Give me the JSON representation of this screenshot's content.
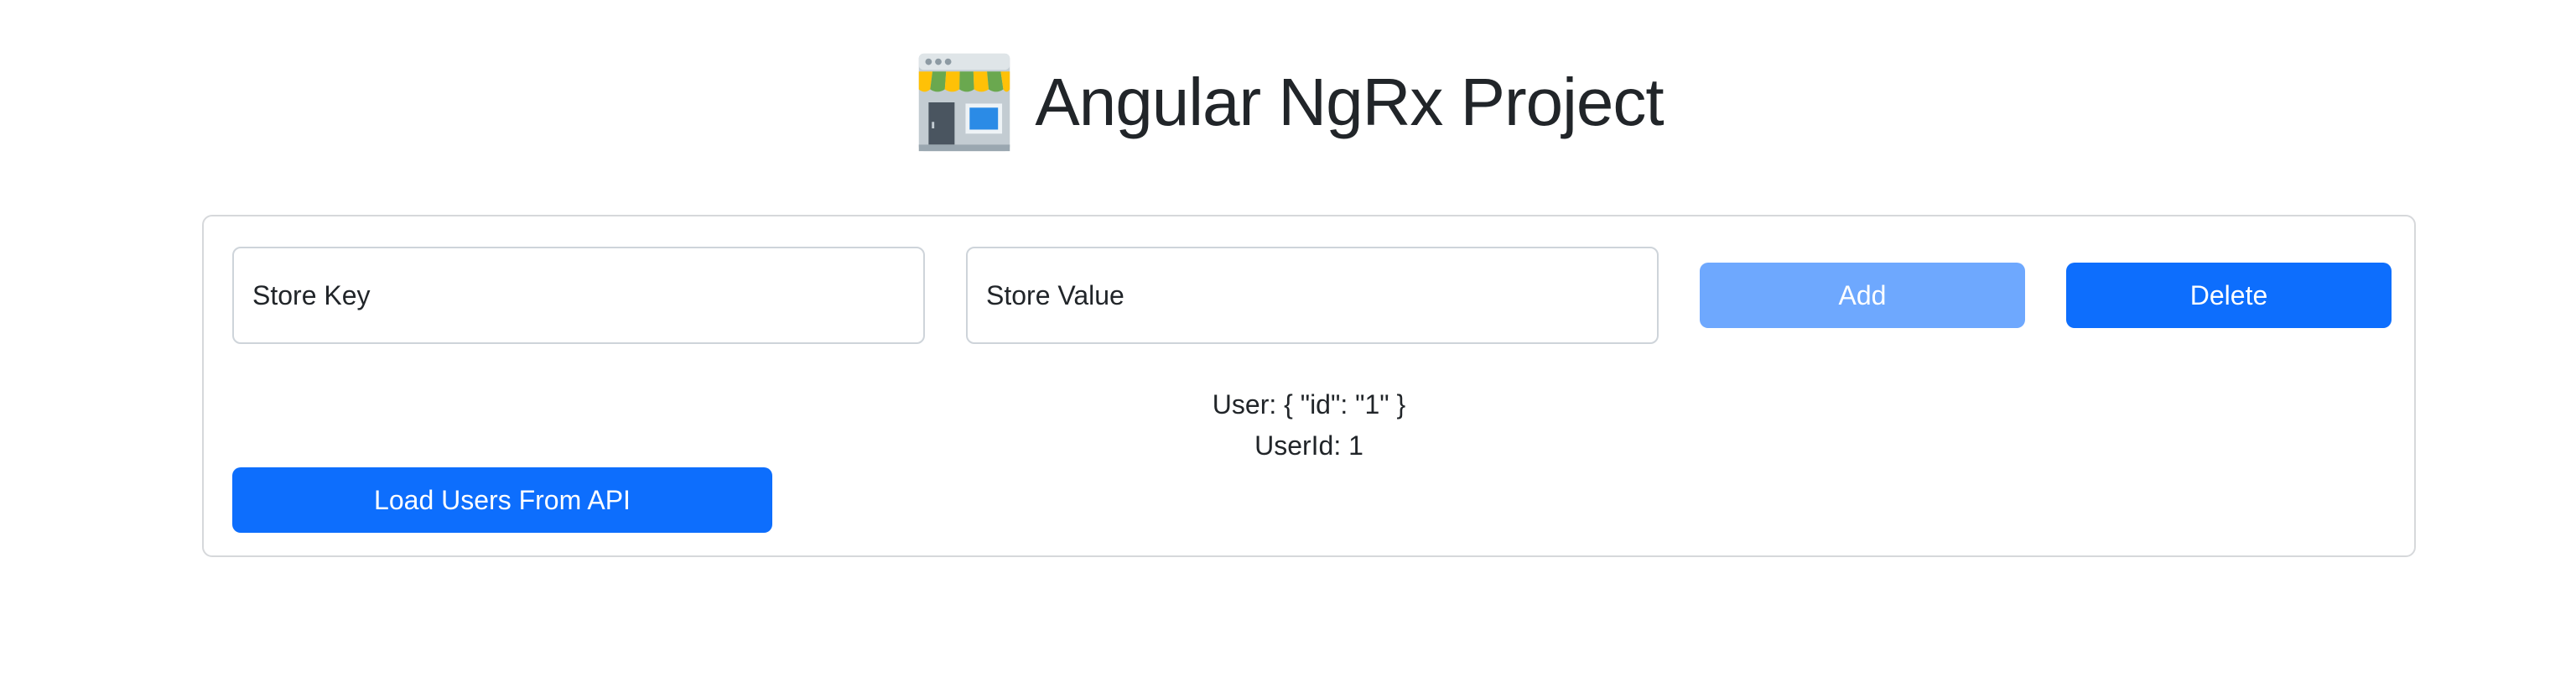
{
  "header": {
    "title": "Angular NgRx Project",
    "logo_icon": "storefront-icon"
  },
  "form": {
    "store_key_placeholder": "Store Key",
    "store_value_placeholder": "Store Value",
    "add_label": "Add",
    "delete_label": "Delete",
    "add_disabled": true
  },
  "state": {
    "user_text": "User: { \"id\": \"1\" }",
    "userid_text": "UserId: 1"
  },
  "actions": {
    "load_users_label": "Load Users From API"
  },
  "colors": {
    "primary": "#0d6efd",
    "primary_disabled": "#6ea8fe",
    "border": "#ced4da",
    "text": "#212529"
  }
}
